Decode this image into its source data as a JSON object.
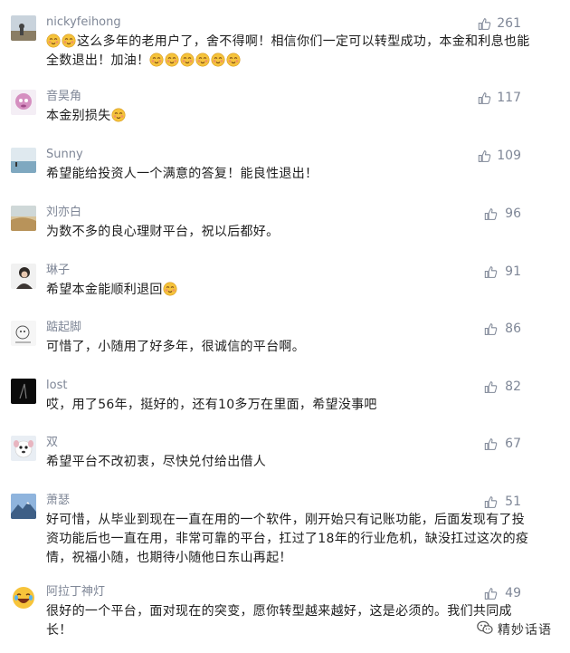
{
  "colors": {
    "nickname": "#7f8797",
    "content": "#1d1d1d",
    "like": "#7f8797",
    "emoji_face": "#f5c33b",
    "emoji_cheek": "#f08a6c"
  },
  "comments": [
    {
      "nickname": "nickyfeihong",
      "likes": "261",
      "lead_emojis": 2,
      "text": "这么多年的老用户了，舍不得啊！相信你们一定可以转型成功，本金和利息也能全数退出！加油！",
      "trail_emojis": 6,
      "avatar_icon": "landscape-avatar-icon"
    },
    {
      "nickname": "音昊角",
      "likes": "117",
      "lead_emojis": 0,
      "text": "本金别损失",
      "trail_emojis": 1,
      "avatar_icon": "cartoon-avatar-icon"
    },
    {
      "nickname": "Sunny",
      "likes": "109",
      "lead_emojis": 0,
      "text": "希望能给投资人一个满意的答复！能良性退出！",
      "trail_emojis": 0,
      "avatar_icon": "sea-avatar-icon"
    },
    {
      "nickname": "刘亦白",
      "likes": "96",
      "lead_emojis": 0,
      "text": "为数不多的良心理财平台，祝以后都好。",
      "trail_emojis": 0,
      "avatar_icon": "desert-avatar-icon"
    },
    {
      "nickname": "琳子",
      "likes": "91",
      "lead_emojis": 0,
      "text": "希望本金能顺利退回",
      "trail_emojis": 1,
      "avatar_icon": "person-avatar-icon"
    },
    {
      "nickname": "踮起脚",
      "likes": "86",
      "lead_emojis": 0,
      "text": "可惜了，小随用了好多年，很诚信的平台啊。",
      "trail_emojis": 0,
      "avatar_icon": "sketch-avatar-icon"
    },
    {
      "nickname": "lost",
      "likes": "82",
      "lead_emojis": 0,
      "text": "哎，用了56年，挺好的，还有10多万在里面，希望没事吧",
      "trail_emojis": 0,
      "avatar_icon": "dark-avatar-icon"
    },
    {
      "nickname": "双",
      "likes": "67",
      "lead_emojis": 0,
      "text": "希望平台不改初衷，尽快兑付给出借人",
      "trail_emojis": 0,
      "avatar_icon": "dog-avatar-icon"
    },
    {
      "nickname": "萧瑟",
      "likes": "51",
      "lead_emojis": 0,
      "text": "好可惜，从毕业到现在一直在用的一个软件，刚开始只有记账功能，后面发现有了投资功能后也一直在用，非常可靠的平台，扛过了18年的行业危机，缺没扛过这次的疫情，祝福小随，也期待小随他日东山再起！",
      "trail_emojis": 0,
      "avatar_icon": "mountain-avatar-icon"
    },
    {
      "nickname": "阿拉丁神灯",
      "likes": "49",
      "lead_emojis": 0,
      "text": "很好的一个平台，面对现在的突变，愿你转型越来越好，这是必须的。我们共同成长！",
      "trail_emojis": 0,
      "avatar_icon": "laughing-avatar-icon"
    }
  ],
  "watermark": {
    "label": "精妙话语",
    "icon": "wechat-icon"
  }
}
